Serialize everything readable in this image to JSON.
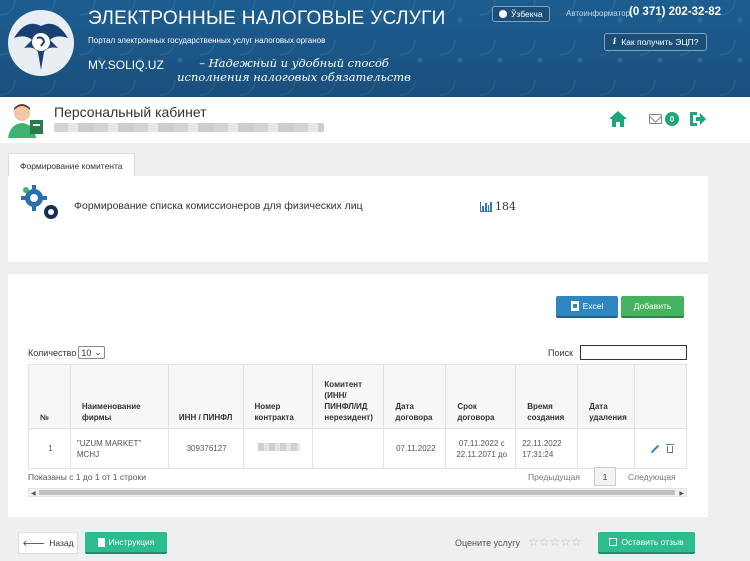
{
  "header": {
    "title": "ЭЛЕКТРОННЫЕ НАЛОГОВЫЕ УСЛУГИ",
    "subtitle": "Портал электронных государственных услуг налоговых органов",
    "site": "MY.SOLIQ.UZ",
    "slogan": "–  Надежный и удобный способ исполнения налоговых обязательств",
    "language_button": "Ўзбекча",
    "info_label": "Автоинформатор:",
    "info_phone": "(0 371) 202-32-82",
    "eds_button": "Как получить ЭЦП?"
  },
  "user": {
    "cabinet_title": "Персональный кабинет",
    "notifications_count": "0"
  },
  "tab": {
    "label": "Формирование комитента"
  },
  "service": {
    "title": "Формирование списка комиссионеров для физических лиц",
    "count": "184"
  },
  "toolbar": {
    "excel_label": "Excel",
    "add_label": "Добавить"
  },
  "table_controls": {
    "quantity_label": "Количество",
    "quantity_value": "10",
    "search_label": "Поиск",
    "search_value": ""
  },
  "table": {
    "headers": [
      "№",
      "Наименование фирмы",
      "ИНН / ПИНФЛ",
      "Номер контракта",
      "Комитент (ИНН/ ПИНФЛ/ИД нерезидент)",
      "Дата договора",
      "Срок договора",
      "Время создания",
      "Дата удаления",
      ""
    ],
    "rows": [
      {
        "num": "1",
        "firm": "\"UZUM MARKET\" MCHJ",
        "inn": "309376127",
        "contract": "",
        "komitent": "",
        "contract_date": "07.11.2022",
        "term": "07.11.2022 с 22.11.2071 до",
        "created": "22.11.2022 17:31:24",
        "deleted": ""
      }
    ]
  },
  "pagination": {
    "summary": "Показаны с 1 до 1 от 1 строки",
    "prev": "Предыдущая",
    "page": "1",
    "next": "Следующая"
  },
  "footer": {
    "back_label": "Назад",
    "instruction_label": "Инструкция",
    "rate_label": "Оцените услугу",
    "stars": "☆☆☆☆☆",
    "feedback_label": "Оставить отзыв"
  }
}
